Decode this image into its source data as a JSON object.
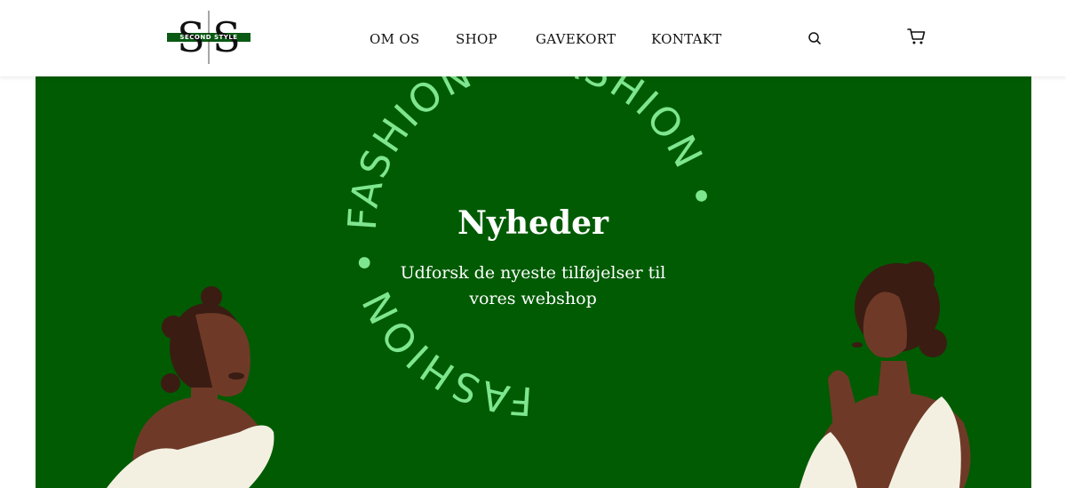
{
  "brand": {
    "logo_letters": "SS",
    "logo_band_text": "SECOND STYLE",
    "brand_color": "#0a5a14"
  },
  "nav": {
    "items": [
      {
        "label": "OM OS"
      },
      {
        "label": "SHOP"
      },
      {
        "label": "GAVEKORT"
      },
      {
        "label": "KONTAKT"
      }
    ]
  },
  "header_icons": {
    "search": "search-icon",
    "cart": "cart-icon"
  },
  "hero": {
    "title": "Nyheder",
    "subtitle_line1": "Udforsk de nyeste tilføjelser til",
    "subtitle_line2": "vores webshop",
    "ring_text": "FASHION • FASHION • FASHION •",
    "background_color": "#005b02",
    "ring_text_color": "#7ee68f"
  }
}
